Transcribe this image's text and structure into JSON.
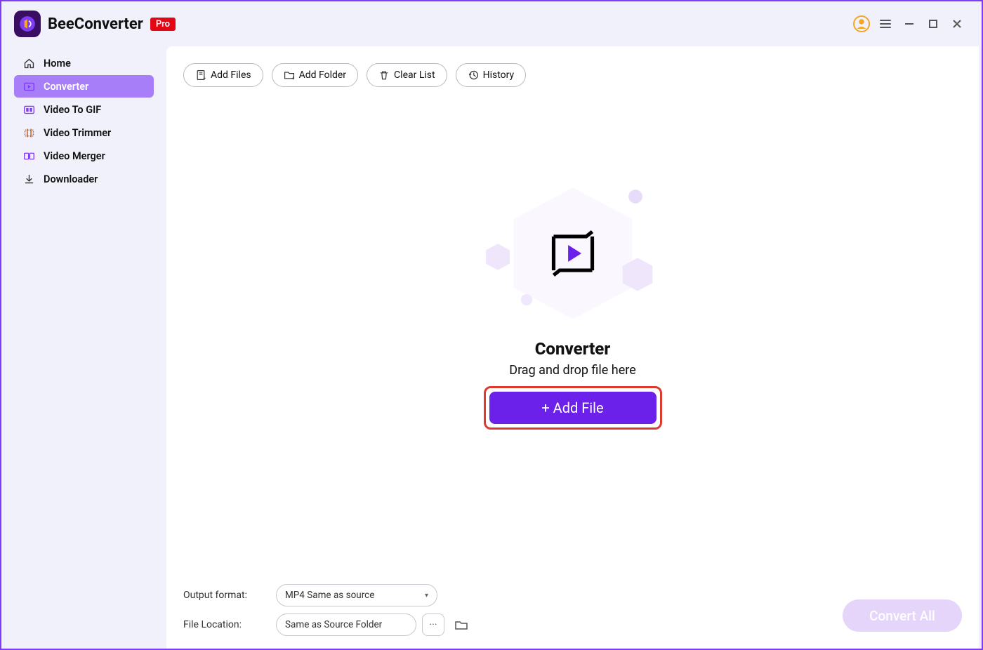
{
  "app": {
    "title": "BeeConverter",
    "pro_badge": "Pro"
  },
  "titlebar": {
    "user_icon": "user-circle",
    "menu_icon": "hamburger",
    "minimize_icon": "minimize",
    "maximize_icon": "maximize",
    "close_icon": "close"
  },
  "sidebar": {
    "items": [
      {
        "key": "home",
        "label": "Home",
        "icon": "home",
        "active": false
      },
      {
        "key": "converter",
        "label": "Converter",
        "icon": "play-rect",
        "active": true
      },
      {
        "key": "videotogif",
        "label": "Video To GIF",
        "icon": "gif-rect",
        "active": false
      },
      {
        "key": "videotrimmer",
        "label": "Video Trimmer",
        "icon": "trim",
        "active": false
      },
      {
        "key": "videomerger",
        "label": "Video Merger",
        "icon": "merge",
        "active": false
      },
      {
        "key": "downloader",
        "label": "Downloader",
        "icon": "download",
        "active": false
      }
    ]
  },
  "toolbar": {
    "add_files": "Add Files",
    "add_folder": "Add Folder",
    "clear_list": "Clear List",
    "history": "History"
  },
  "empty": {
    "title": "Converter",
    "subtitle": "Drag and drop file here",
    "add_file_button": "+ Add File"
  },
  "footer": {
    "output_format_label": "Output format:",
    "output_format_value": "MP4 Same as source",
    "file_location_label": "File Location:",
    "file_location_value": "Same as Source Folder",
    "convert_all": "Convert All"
  },
  "colors": {
    "accent": "#7e3cf5",
    "accent_dark": "#6b21ea",
    "sidebar_active": "#a77ef8",
    "badge_red": "#e30613",
    "highlight_red": "#dc3a2e",
    "disabled_purple": "#e5d5fb"
  }
}
